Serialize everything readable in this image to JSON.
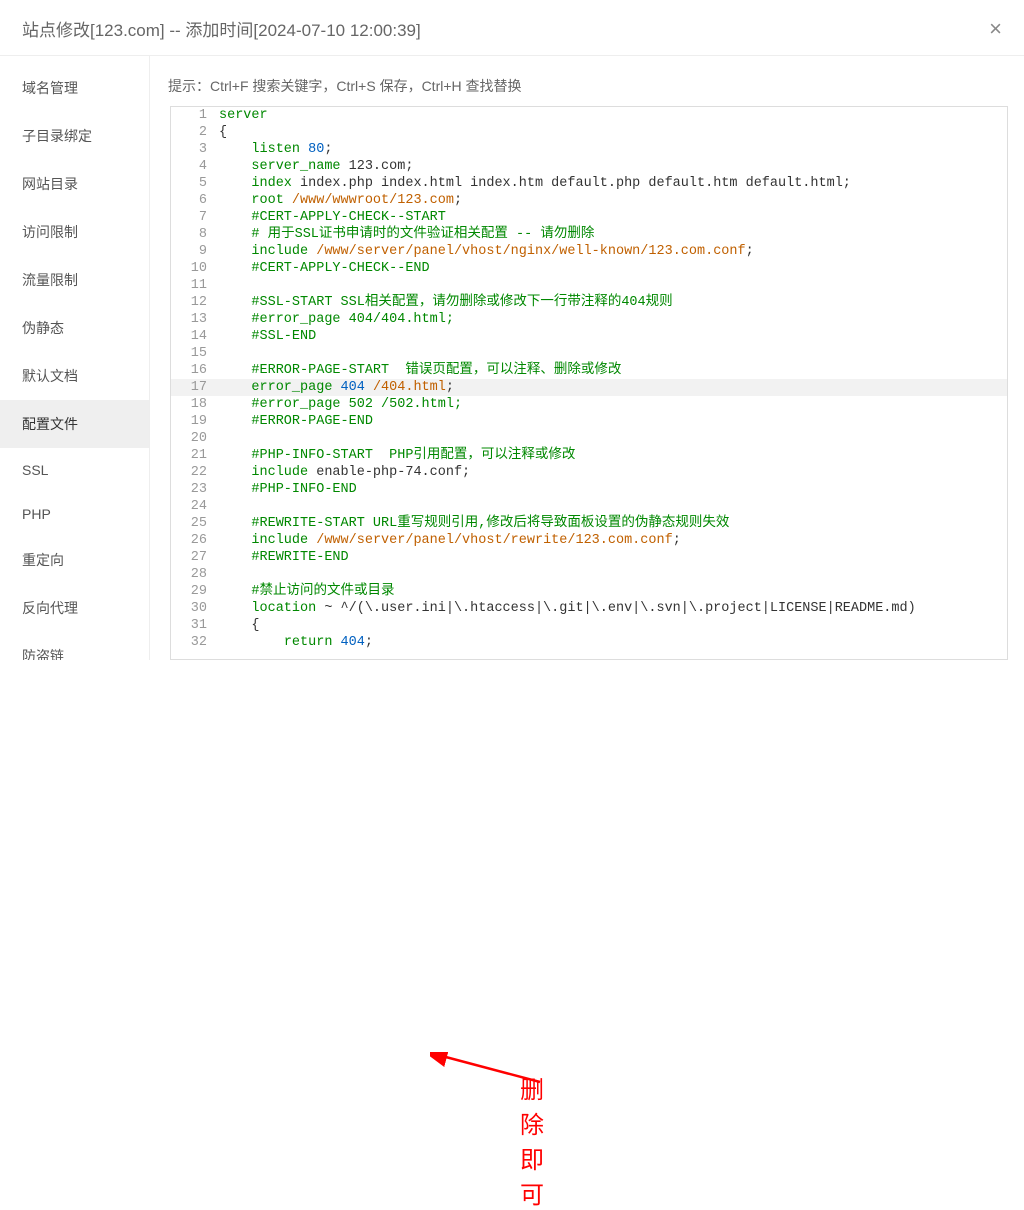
{
  "titlebar": {
    "title": "站点修改[123.com] -- 添加时间[2024-07-10 12:00:39]",
    "close_glyph": "×"
  },
  "sidebar": {
    "items": [
      {
        "name": "domain-manage",
        "label": "域名管理"
      },
      {
        "name": "subdir-bind",
        "label": "子目录绑定"
      },
      {
        "name": "site-dir",
        "label": "网站目录"
      },
      {
        "name": "access-limit",
        "label": "访问限制"
      },
      {
        "name": "traffic-limit",
        "label": "流量限制"
      },
      {
        "name": "pseudo-static",
        "label": "伪静态"
      },
      {
        "name": "default-doc",
        "label": "默认文档"
      },
      {
        "name": "config-file",
        "label": "配置文件"
      },
      {
        "name": "ssl",
        "label": "SSL"
      },
      {
        "name": "php",
        "label": "PHP"
      },
      {
        "name": "redirect",
        "label": "重定向"
      },
      {
        "name": "reverse-proxy",
        "label": "反向代理"
      },
      {
        "name": "anti-leech",
        "label": "防盗链"
      }
    ],
    "active_index": 7
  },
  "hint": "提示：Ctrl+F 搜索关键字，Ctrl+S 保存，Ctrl+H 查找替换",
  "annotation": {
    "text": "删除即可"
  },
  "editor": {
    "highlight_line": 17,
    "lines": [
      [
        {
          "c": "kw",
          "t": "server"
        }
      ],
      [
        {
          "c": "id",
          "t": "{"
        }
      ],
      [
        {
          "c": "id",
          "t": "    "
        },
        {
          "c": "kw",
          "t": "listen"
        },
        {
          "c": "id",
          "t": " "
        },
        {
          "c": "num",
          "t": "80"
        },
        {
          "c": "id",
          "t": ";"
        }
      ],
      [
        {
          "c": "id",
          "t": "    "
        },
        {
          "c": "kw",
          "t": "server_name"
        },
        {
          "c": "id",
          "t": " 123.com;"
        }
      ],
      [
        {
          "c": "id",
          "t": "    "
        },
        {
          "c": "kw",
          "t": "index"
        },
        {
          "c": "id",
          "t": " index.php index.html index.htm default.php default.htm default.html;"
        }
      ],
      [
        {
          "c": "id",
          "t": "    "
        },
        {
          "c": "kw",
          "t": "root"
        },
        {
          "c": "id",
          "t": " "
        },
        {
          "c": "str",
          "t": "/www/wwwroot/123.com"
        },
        {
          "c": "id",
          "t": ";"
        }
      ],
      [
        {
          "c": "id",
          "t": "    "
        },
        {
          "c": "cm",
          "t": "#CERT-APPLY-CHECK--START"
        }
      ],
      [
        {
          "c": "id",
          "t": "    "
        },
        {
          "c": "cm",
          "t": "# 用于SSL证书申请时的文件验证相关配置 -- 请勿删除"
        }
      ],
      [
        {
          "c": "id",
          "t": "    "
        },
        {
          "c": "kw",
          "t": "include"
        },
        {
          "c": "id",
          "t": " "
        },
        {
          "c": "str",
          "t": "/www/server/panel/vhost/nginx/well-known/123.com.conf"
        },
        {
          "c": "id",
          "t": ";"
        }
      ],
      [
        {
          "c": "id",
          "t": "    "
        },
        {
          "c": "cm",
          "t": "#CERT-APPLY-CHECK--END"
        }
      ],
      [
        {
          "c": "id",
          "t": ""
        }
      ],
      [
        {
          "c": "id",
          "t": "    "
        },
        {
          "c": "cm",
          "t": "#SSL-START SSL相关配置，请勿删除或修改下一行带注释的404规则"
        }
      ],
      [
        {
          "c": "id",
          "t": "    "
        },
        {
          "c": "cm",
          "t": "#error_page 404/404.html;"
        }
      ],
      [
        {
          "c": "id",
          "t": "    "
        },
        {
          "c": "cm",
          "t": "#SSL-END"
        }
      ],
      [
        {
          "c": "id",
          "t": ""
        }
      ],
      [
        {
          "c": "id",
          "t": "    "
        },
        {
          "c": "cm",
          "t": "#ERROR-PAGE-START  错误页配置，可以注释、删除或修改"
        }
      ],
      [
        {
          "c": "id",
          "t": "    "
        },
        {
          "c": "kw",
          "t": "error_page"
        },
        {
          "c": "id",
          "t": " "
        },
        {
          "c": "num",
          "t": "404"
        },
        {
          "c": "id",
          "t": " "
        },
        {
          "c": "str",
          "t": "/404.html"
        },
        {
          "c": "id",
          "t": ";"
        }
      ],
      [
        {
          "c": "id",
          "t": "    "
        },
        {
          "c": "cm",
          "t": "#error_page 502 /502.html;"
        }
      ],
      [
        {
          "c": "id",
          "t": "    "
        },
        {
          "c": "cm",
          "t": "#ERROR-PAGE-END"
        }
      ],
      [
        {
          "c": "id",
          "t": ""
        }
      ],
      [
        {
          "c": "id",
          "t": "    "
        },
        {
          "c": "cm",
          "t": "#PHP-INFO-START  PHP引用配置，可以注释或修改"
        }
      ],
      [
        {
          "c": "id",
          "t": "    "
        },
        {
          "c": "kw",
          "t": "include"
        },
        {
          "c": "id",
          "t": " enable-php-74.conf;"
        }
      ],
      [
        {
          "c": "id",
          "t": "    "
        },
        {
          "c": "cm",
          "t": "#PHP-INFO-END"
        }
      ],
      [
        {
          "c": "id",
          "t": ""
        }
      ],
      [
        {
          "c": "id",
          "t": "    "
        },
        {
          "c": "cm",
          "t": "#REWRITE-START URL重写规则引用,修改后将导致面板设置的伪静态规则失效"
        }
      ],
      [
        {
          "c": "id",
          "t": "    "
        },
        {
          "c": "kw",
          "t": "include"
        },
        {
          "c": "id",
          "t": " "
        },
        {
          "c": "str",
          "t": "/www/server/panel/vhost/rewrite/123.com.conf"
        },
        {
          "c": "id",
          "t": ";"
        }
      ],
      [
        {
          "c": "id",
          "t": "    "
        },
        {
          "c": "cm",
          "t": "#REWRITE-END"
        }
      ],
      [
        {
          "c": "id",
          "t": ""
        }
      ],
      [
        {
          "c": "id",
          "t": "    "
        },
        {
          "c": "cm",
          "t": "#禁止访问的文件或目录"
        }
      ],
      [
        {
          "c": "id",
          "t": "    "
        },
        {
          "c": "kw",
          "t": "location"
        },
        {
          "c": "id",
          "t": " ~ ^/(\\.user.ini|\\.htaccess|\\.git|\\.env|\\.svn|\\.project|LICENSE|README.md)"
        }
      ],
      [
        {
          "c": "id",
          "t": "    {"
        }
      ],
      [
        {
          "c": "id",
          "t": "        "
        },
        {
          "c": "kw",
          "t": "return"
        },
        {
          "c": "id",
          "t": " "
        },
        {
          "c": "num",
          "t": "404"
        },
        {
          "c": "id",
          "t": ";"
        }
      ]
    ]
  }
}
